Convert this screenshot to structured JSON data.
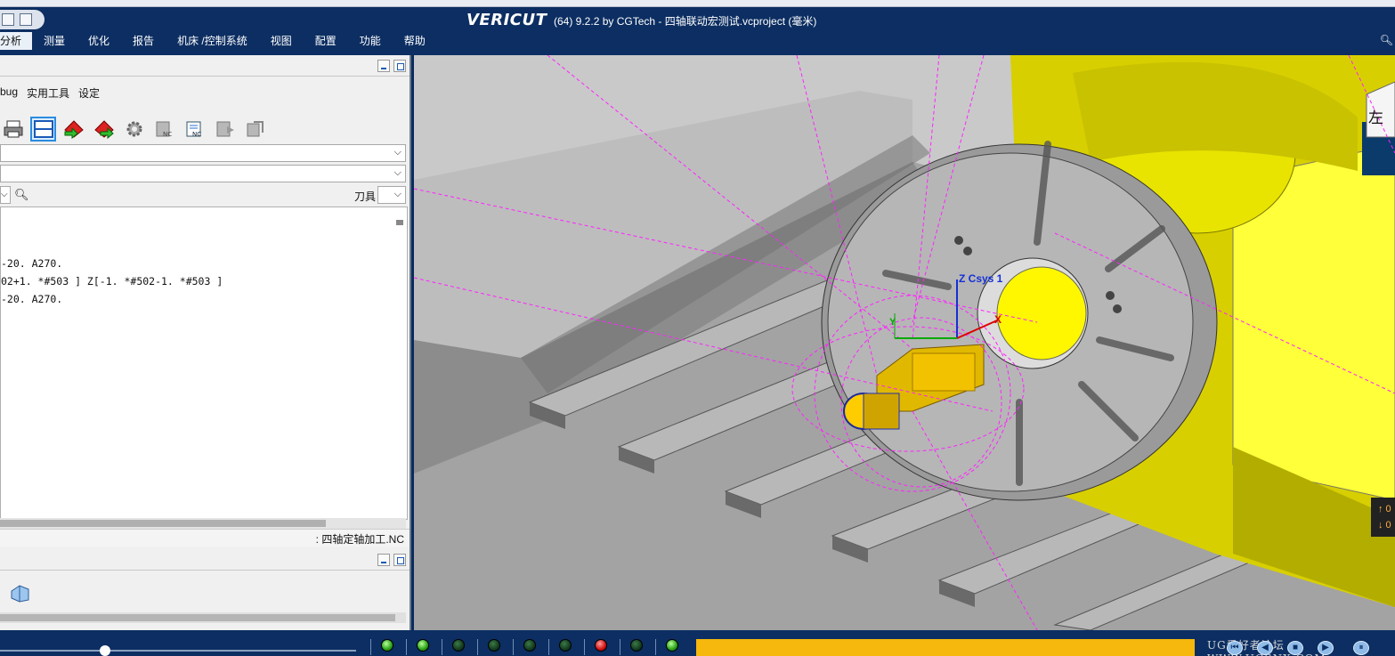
{
  "title_bar": {
    "logo": "VERICUT",
    "window_title": "(64)  9.2.2 by CGTech - 四轴联动宏测试.vcproject (毫米)"
  },
  "menu": {
    "items": [
      "分析",
      "测量",
      "优化",
      "报告",
      "机床 /控制系统",
      "视图",
      "配置",
      "功能",
      "帮助"
    ]
  },
  "nc_panel": {
    "tabs": [
      "bug",
      "实用工具",
      "设定"
    ],
    "toolbar_icons": [
      "print-icon",
      "split-view-icon",
      "step-back-icon",
      "step-forward-icon",
      "gear-icon",
      "nc-program-icon",
      "nc-file-icon",
      "next-icon",
      "refresh-icon"
    ],
    "tool_label": "刀具",
    "code_lines": [
      "-20. A270.",
      "02+1. *#503 ] Z[-1. *#502-1. *#503 ]",
      "-20. A270."
    ],
    "file_name": ": 四轴定轴加工.NC"
  },
  "viewport": {
    "csys_label": "Z Csys 1",
    "x_axis_label": "X",
    "y_axis_label": "Y",
    "view_cube_label": "左",
    "indicator": [
      "↑ 0",
      "↓ 0"
    ]
  },
  "status": {
    "leds": [
      "green",
      "green",
      "dark",
      "dark",
      "dark",
      "dark",
      "red",
      "dark",
      "green"
    ],
    "watermark": "UG爱好者论坛 WWW.UGSNX.COM"
  }
}
